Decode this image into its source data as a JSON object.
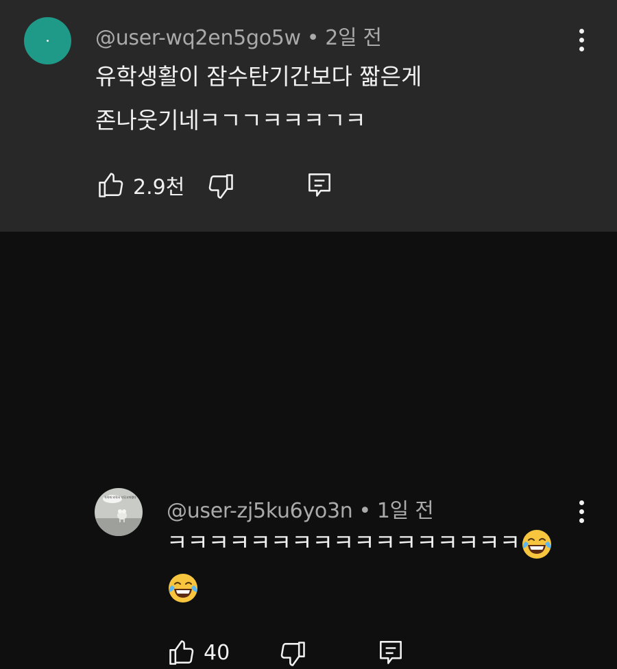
{
  "comments": [
    {
      "author": "@user-wq2en5go5w",
      "time": "2일 전",
      "lines": [
        "유학생활이 잠수탄기간보다 짧은게",
        "존나웃기네ㅋㄱㄱㅋㅋㅋㄱㅋ"
      ],
      "likes": "2.9천"
    },
    {
      "author": "@user-zj5ku6yo3n",
      "time": "1일 전",
      "text": "ㅋㅋㅋㅋㅋㅋㅋㅋㅋㅋㅋㅋㅋㅋㅋㅋㅋ",
      "likes": "40",
      "avatar_caption": "쥐쥐에 와줘서 너무고마웠다"
    }
  ],
  "icons": {
    "separator": "•",
    "emoji": "face-with-tears-of-joy",
    "like": "thumbs-up-icon",
    "dislike": "thumbs-down-icon",
    "reply": "comment-icon",
    "more": "more-vertical-icon"
  },
  "colors": {
    "top_bg": "#282828",
    "reply_bg": "#0f0f0f",
    "avatar_teal": "#1f9a88",
    "meta_text": "#aaaaaa"
  }
}
